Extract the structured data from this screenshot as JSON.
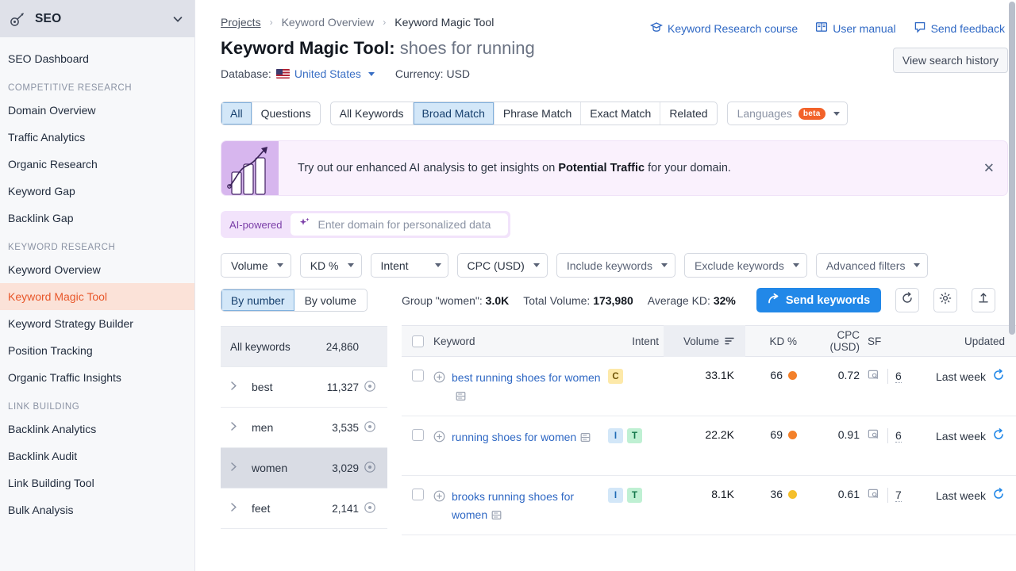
{
  "sidebar": {
    "brand": "SEO",
    "brand_icon": "key-icon",
    "collapse_icon": "chevron-down-icon",
    "dashboard": "SEO Dashboard",
    "groups": [
      {
        "label": "COMPETITIVE RESEARCH",
        "items": [
          "Domain Overview",
          "Traffic Analytics",
          "Organic Research",
          "Keyword Gap",
          "Backlink Gap"
        ]
      },
      {
        "label": "KEYWORD RESEARCH",
        "items": [
          "Keyword Overview",
          "Keyword Magic Tool",
          "Keyword Strategy Builder",
          "Position Tracking",
          "Organic Traffic Insights"
        ]
      },
      {
        "label": "LINK BUILDING",
        "items": [
          "Backlink Analytics",
          "Backlink Audit",
          "Link Building Tool",
          "Bulk Analysis"
        ]
      }
    ],
    "active_item": "Keyword Magic Tool",
    "active_color": "#e8572a"
  },
  "breadcrumb": {
    "root": "Projects",
    "middle": "Keyword Overview",
    "current": "Keyword Magic Tool",
    "separator": "›"
  },
  "header": {
    "title": "Keyword Magic Tool:",
    "keyword": "shoes for running",
    "database_label": "Database:",
    "database_value": "United States",
    "currency_label": "Currency:",
    "currency_value": "USD",
    "links": [
      {
        "label": "Keyword Research course",
        "icon": "graduation-cap-icon"
      },
      {
        "label": "User manual",
        "icon": "book-icon"
      },
      {
        "label": "Send feedback",
        "icon": "speech-bubble-icon"
      }
    ],
    "history_button": "View search history"
  },
  "tabs": {
    "group1": [
      {
        "label": "All",
        "selected": true
      },
      {
        "label": "Questions",
        "selected": false
      }
    ],
    "group2": [
      {
        "label": "All Keywords",
        "selected": false
      },
      {
        "label": "Broad Match",
        "selected": true
      },
      {
        "label": "Phrase Match",
        "selected": false
      },
      {
        "label": "Exact Match",
        "selected": false
      },
      {
        "label": "Related",
        "selected": false
      }
    ],
    "languages": {
      "label": "Languages",
      "badge": "beta",
      "badge_color": "#f2622a",
      "icon": "chevron-down-icon"
    }
  },
  "banner": {
    "text_before": "Try out our enhanced AI analysis to get insights on ",
    "text_bold": "Potential Traffic",
    "text_after": " for your domain.",
    "close_icon": "close-icon",
    "art_icon": "growth-chart-icon",
    "bg": "#faf1fd",
    "art_bg": "#d7b6ee"
  },
  "ai_row": {
    "tag": "AI-powered",
    "sparkle_icon": "sparkle-icon",
    "placeholder": "Enter domain for personalized data",
    "value": ""
  },
  "filters": [
    {
      "label": "Volume",
      "muted": false
    },
    {
      "label": "KD %",
      "muted": false
    },
    {
      "label": "Intent",
      "muted": false
    },
    {
      "label": "CPC (USD)",
      "muted": false
    },
    {
      "label": "Include keywords",
      "muted": true
    },
    {
      "label": "Exclude keywords",
      "muted": true
    },
    {
      "label": "Advanced filters",
      "muted": true
    }
  ],
  "groups_panel": {
    "toggle": [
      {
        "label": "By number",
        "selected": true
      },
      {
        "label": "By volume",
        "selected": false
      }
    ],
    "all_keywords_label": "All keywords",
    "all_keywords_count": "24,860",
    "rows": [
      {
        "label": "best",
        "count": "11,327",
        "selected": false
      },
      {
        "label": "men",
        "count": "3,535",
        "selected": false
      },
      {
        "label": "women",
        "count": "3,029",
        "selected": true
      },
      {
        "label": "feet",
        "count": "2,141",
        "selected": false
      }
    ],
    "expand_icon": "chevron-right-icon",
    "eye_icon": "eye-icon"
  },
  "stats": {
    "group_label": "Group \"women\":",
    "group_value": "3.0K",
    "total_label": "Total Volume:",
    "total_value": "173,980",
    "avgkd_label": "Average KD:",
    "avgkd_value": "32%",
    "send_button": "Send keywords",
    "send_icon": "share-arrow-icon",
    "send_color": "#2288e8",
    "refresh_icon": "refresh-icon",
    "settings_icon": "gear-icon",
    "export_icon": "export-icon"
  },
  "table": {
    "columns": [
      "Keyword",
      "Intent",
      "Volume",
      "KD %",
      "CPC (USD)",
      "SF",
      "Updated"
    ],
    "sorted_column": "Volume",
    "sort_icon": "sort-descending-icon",
    "rows": [
      {
        "keyword": "best running shoes for women",
        "intent": [
          {
            "code": "C",
            "color": "#fde9a9"
          }
        ],
        "volume": "33.1K",
        "kd": "66",
        "kd_color": "#f3802a",
        "cpc": "0.72",
        "sf": "6",
        "updated": "Last week"
      },
      {
        "keyword": "running shoes for women",
        "intent": [
          {
            "code": "I",
            "color": "#d3e7f8"
          },
          {
            "code": "T",
            "color": "#bff0d3"
          }
        ],
        "volume": "22.2K",
        "kd": "69",
        "kd_color": "#f3802a",
        "cpc": "0.91",
        "sf": "6",
        "updated": "Last week"
      },
      {
        "keyword": "brooks running shoes for women",
        "intent": [
          {
            "code": "I",
            "color": "#d3e7f8"
          },
          {
            "code": "T",
            "color": "#bff0d3"
          }
        ],
        "volume": "8.1K",
        "kd": "36",
        "kd_color": "#f5bf2b",
        "cpc": "0.61",
        "sf": "7",
        "updated": "Last week"
      }
    ],
    "row_icons": {
      "add_icon": "plus-circle-icon",
      "serp_icon": "serp-preview-icon",
      "sf_icon": "serp-features-icon",
      "update_icon": "refresh-icon",
      "checkbox_icon": "checkbox-icon"
    }
  }
}
